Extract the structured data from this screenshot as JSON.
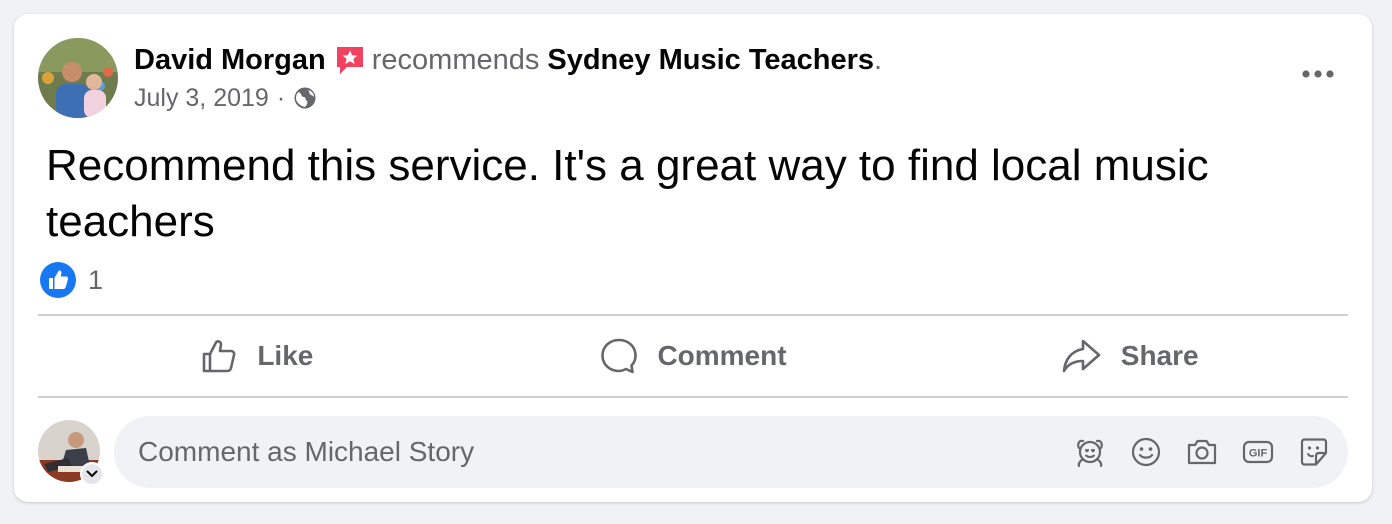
{
  "post": {
    "author": "David Morgan",
    "verb": "recommends",
    "page_name": "Sydney Music Teachers",
    "period": ".",
    "date": "July 3, 2019",
    "separator": "·",
    "text": "Recommend this service. It's a great way to find local music teachers",
    "reaction_count": "1"
  },
  "actions": {
    "like_label": "Like",
    "comment_label": "Comment",
    "share_label": "Share"
  },
  "comment": {
    "placeholder": "Comment as Michael Story"
  },
  "icons": {
    "recommend_badge": "recommend-star-icon",
    "audience": "globe-icon",
    "more": "more-horizontal-icon",
    "reaction": "like-reaction-icon",
    "like": "thumbs-up-icon",
    "comment": "speech-bubble-icon",
    "share": "share-arrow-icon",
    "avatar_stickers": "avatar-sticker-icon",
    "emoji": "emoji-icon",
    "camera": "camera-icon",
    "gif": "gif-icon",
    "sticker": "sticker-icon"
  },
  "colors": {
    "accent": "#1877f2",
    "recommend": "#f3425f",
    "secondary_text": "#65676b",
    "primary_text": "#050505"
  }
}
